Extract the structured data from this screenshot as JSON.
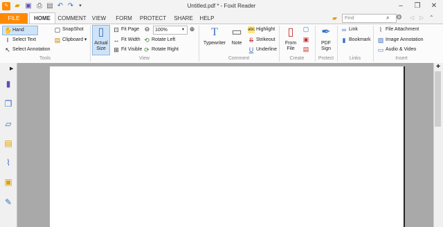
{
  "titlebar": {
    "title": "Untitled.pdf * - Foxit Reader",
    "quick_access": [
      "app-icon",
      "open-icon",
      "save-icon",
      "print-icon",
      "document-icon",
      "undo-icon",
      "redo-icon",
      "customize-icon"
    ],
    "window_buttons": [
      "minimize-icon",
      "restore-icon",
      "close-icon"
    ]
  },
  "tabs": [
    {
      "label": "FILE",
      "active": false
    },
    {
      "label": "HOME",
      "active": true
    },
    {
      "label": "COMMENT",
      "active": false
    },
    {
      "label": "VIEW",
      "active": false
    },
    {
      "label": "FORM",
      "active": false
    },
    {
      "label": "PROTECT",
      "active": false
    },
    {
      "label": "SHARE",
      "active": false
    },
    {
      "label": "HELP",
      "active": false
    }
  ],
  "search": {
    "placeholder": "Find"
  },
  "ribbon": {
    "tools": {
      "label": "Tools",
      "hand": "Hand",
      "select_text": "Select Text",
      "select_annotation": "Select Annotation",
      "snapshot": "SnapShot",
      "clipboard": "Clipboard"
    },
    "view": {
      "label": "View",
      "actual_size": "Actual Size",
      "fit_page": "Fit Page",
      "fit_width": "Fit Width",
      "fit_visible": "Fit Visible",
      "zoom_value": "100%",
      "rotate_left": "Rotate Left",
      "rotate_right": "Rotate Right"
    },
    "comment": {
      "label": "Comment",
      "typewriter": "Typewriter",
      "note": "Note",
      "highlight": "Highlight",
      "strikeout": "Strikeout",
      "underline": "Underline"
    },
    "create": {
      "label": "Create",
      "from_file": "From File"
    },
    "protect": {
      "label": "Protect",
      "pdf_sign": "PDF Sign"
    },
    "links": {
      "label": "Links",
      "link": "Link",
      "bookmark": "Bookmark"
    },
    "insert": {
      "label": "Insert",
      "file_attachment": "File Attachment",
      "image_annotation": "Image Annotation",
      "audio_video": "Audio & Video"
    }
  },
  "colors": {
    "accent": "#ff8a00",
    "workspace": "#a9a9a9",
    "ribbon": "#fbfbfb"
  }
}
